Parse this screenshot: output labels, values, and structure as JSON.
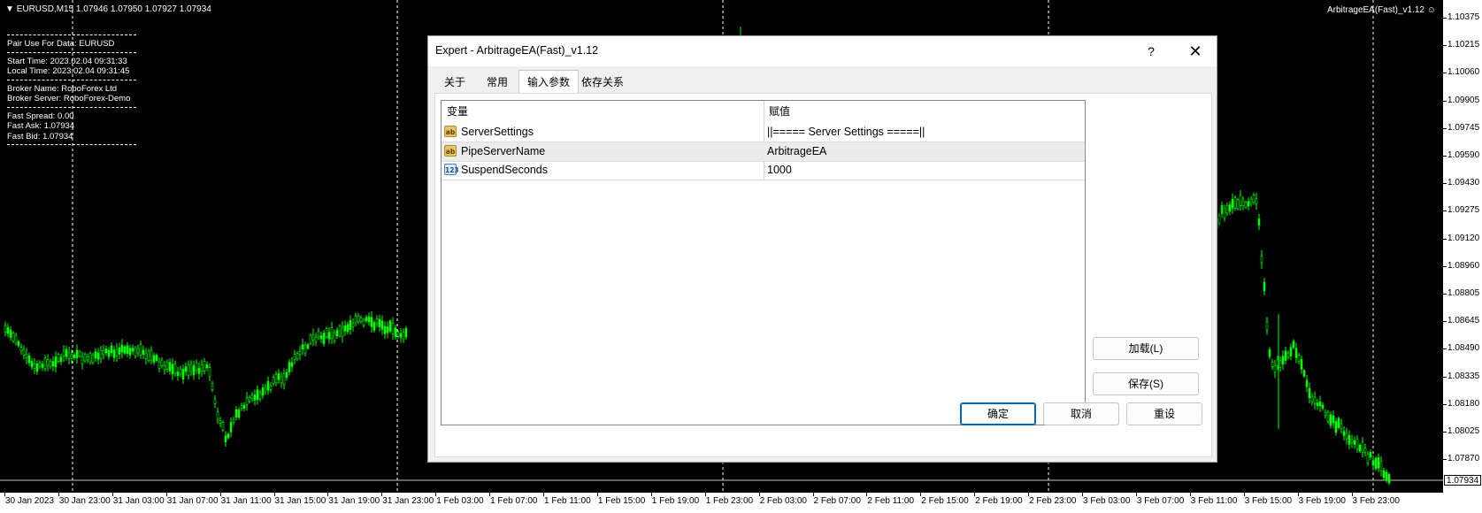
{
  "chart": {
    "header": "EURUSD,M15  1.07946 1.07950 1.07927 1.07934",
    "ea_label": "ArbitrageEA(Fast)_v1.12",
    "info": {
      "pair": "Pair Use For Data: EURUSD",
      "start_time": "Start Time: 2023.02.04 09:31:33",
      "local_time": "Local Time: 2023.02.04 09:31:45",
      "broker_name": "Broker Name: RoboForex Ltd",
      "broker_server": "Broker Server: RoboForex-Demo",
      "fast_spread": "Fast Spread: 0.00",
      "fast_ask": "Fast Ask: 1.07934",
      "fast_bid": "Fast Bid: 1.07934"
    },
    "current_price": "1.07934",
    "price_labels": [
      "1.10375",
      "1.10215",
      "1.10060",
      "1.09905",
      "1.09745",
      "1.09590",
      "1.09430",
      "1.09275",
      "1.09120",
      "1.08960",
      "1.08805",
      "1.08645",
      "1.08490",
      "1.08335",
      "1.08180",
      "1.08025",
      "1.07870"
    ],
    "time_labels": [
      "30 Jan 2023",
      "30 Jan 23:00",
      "31 Jan 03:00",
      "31 Jan 07:00",
      "31 Jan 11:00",
      "31 Jan 15:00",
      "31 Jan 19:00",
      "31 Jan 23:00",
      "1 Feb 03:00",
      "1 Feb 07:00",
      "1 Feb 11:00",
      "1 Feb 15:00",
      "1 Feb 19:00",
      "1 Feb 23:00",
      "2 Feb 03:00",
      "2 Feb 07:00",
      "2 Feb 11:00",
      "2 Feb 15:00",
      "2 Feb 19:00",
      "2 Feb 23:00",
      "3 Feb 03:00",
      "3 Feb 07:00",
      "3 Feb 11:00",
      "3 Feb 15:00",
      "3 Feb 19:00",
      "3 Feb 23:00"
    ],
    "colors": {
      "background": "#000000",
      "candle": "#00ff00",
      "grid": "#ffffff"
    }
  },
  "dialog": {
    "title": "Expert - ArbitrageEA(Fast)_v1.12",
    "help": "?",
    "close": "✕",
    "tabs": [
      "关于",
      "常用",
      "输入参数",
      "依存关系"
    ],
    "active_tab": "输入参数",
    "table": {
      "headers": [
        "变量",
        "赋值"
      ],
      "rows": [
        {
          "icon": "ab",
          "name": "ServerSettings",
          "value": "||===== Server Settings =====||"
        },
        {
          "icon": "ab",
          "name": "PipeServerName",
          "value": "ArbitrageEA"
        },
        {
          "icon": "123",
          "name": "SuspendSeconds",
          "value": "1000"
        }
      ]
    },
    "buttons": {
      "load": "加载(L)",
      "save": "保存(S)",
      "ok": "确定",
      "cancel": "取消",
      "reset": "重设"
    }
  }
}
